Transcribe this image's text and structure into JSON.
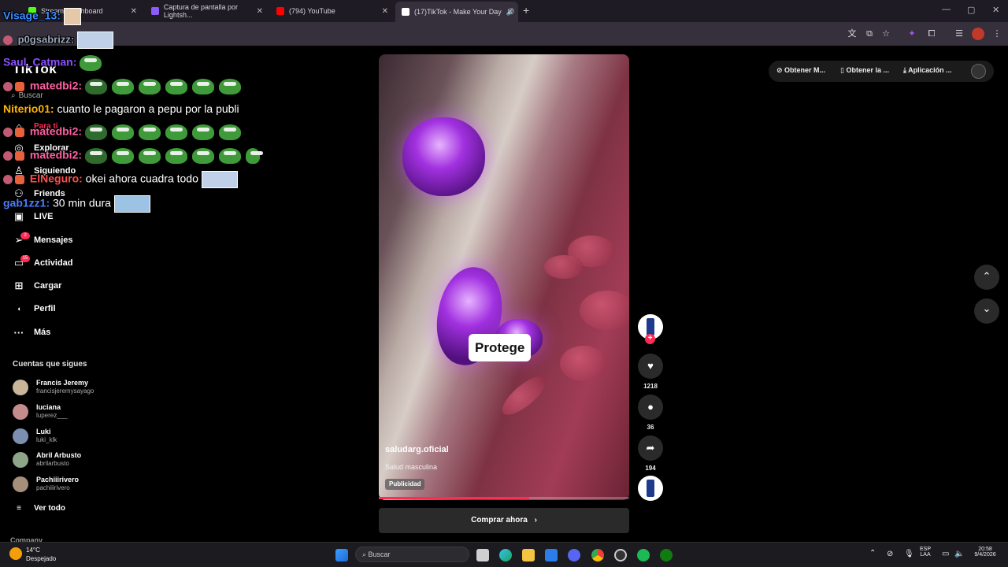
{
  "browser": {
    "tabs": [
      {
        "title": "Stream - X...hboard",
        "icon_color": "#53fc18"
      },
      {
        "title": "Captura de pantalla por Lightsh...",
        "icon_color": "#8b5cf6"
      },
      {
        "title": "(794) YouTube",
        "icon_color": "#ff0000"
      },
      {
        "title": "(17)TikTok - Make Your Day",
        "icon_color": "#ffffff"
      }
    ],
    "new_tab": "+",
    "tab_close": "✕",
    "window_controls": [
      "—",
      "▢",
      "✕"
    ]
  },
  "sidebar": {
    "logo": "TikTok",
    "search_placeholder": "Buscar",
    "nav": [
      {
        "label": "Para ti",
        "icon": "home-icon"
      },
      {
        "label": "Explorar",
        "icon": "compass-icon"
      },
      {
        "label": "Siguiendo",
        "icon": "following-icon"
      },
      {
        "label": "Friends",
        "icon": "friends-icon"
      },
      {
        "label": "LIVE",
        "icon": "live-icon"
      },
      {
        "label": "Mensajes",
        "icon": "messages-icon",
        "badge": "2"
      },
      {
        "label": "Actividad",
        "icon": "activity-icon",
        "badge": "15"
      },
      {
        "label": "Cargar",
        "icon": "upload-icon"
      },
      {
        "label": "Perfil",
        "icon": "profile-icon"
      },
      {
        "label": "Más",
        "icon": "more-icon"
      }
    ],
    "following_title": "Cuentas que sigues",
    "following": [
      {
        "name": "Francis Jeremy",
        "user": "francisjeremysayago",
        "color": "#c9b59a"
      },
      {
        "name": "luciana",
        "user": "luperez___",
        "color": "#c48c8c"
      },
      {
        "name": "Luki",
        "user": "luki_klk",
        "color": "#7d8fb0"
      },
      {
        "name": "Abril Arbusto",
        "user": "abrilarbusto",
        "color": "#8ea58a"
      },
      {
        "name": "Pachiiirivero",
        "user": "pachiiirivero",
        "color": "#a68f7a"
      }
    ],
    "see_all": "Ver todo",
    "company": "Company"
  },
  "chat": [
    {
      "user": "Visage_13:",
      "color": "#3b8cff",
      "msg": ""
    },
    {
      "user": "p0gsabrizz:",
      "color": "#9aa6b8",
      "msg": ""
    },
    {
      "user": "Saul_Catman:",
      "color": "#8a4fff",
      "msg": ""
    },
    {
      "user": "matedbi2:",
      "color": "#ff5fa2",
      "msg": ""
    },
    {
      "user": "Niterio01:",
      "color": "#ffb300",
      "msg": " cuanto le pagaron a pepu por la publi"
    },
    {
      "user": "matedbi2:",
      "color": "#ff5fa2",
      "msg": ""
    },
    {
      "user": "matedbi2:",
      "color": "#ff5fa2",
      "msg": ""
    },
    {
      "user": "ElNeguro:",
      "color": "#ff4d4d",
      "msg": " okei ahora cuadra todo"
    },
    {
      "user": "gab1zz1:",
      "color": "#4d7dff",
      "msg": " 30 min dura"
    }
  ],
  "video": {
    "overlay_text": "Protege",
    "author": "saludarg.oficial",
    "caption": "Salud masculina",
    "ad_label": "Publicidad",
    "progress": 0.6,
    "cta": "Comprar ahora"
  },
  "actions": {
    "likes": "1218",
    "comments": "36",
    "shares": "194"
  },
  "top_right": {
    "get_coins": "Obtener M...",
    "get_app": "Obtener la ...",
    "desktop_app": "Aplicación ..."
  },
  "taskbar": {
    "temperature": "14°C",
    "weather": "Despejado",
    "search_placeholder": "Buscar",
    "language": "ESP",
    "layout": "LAA",
    "time": "20:58",
    "date": "9/4/2026"
  }
}
